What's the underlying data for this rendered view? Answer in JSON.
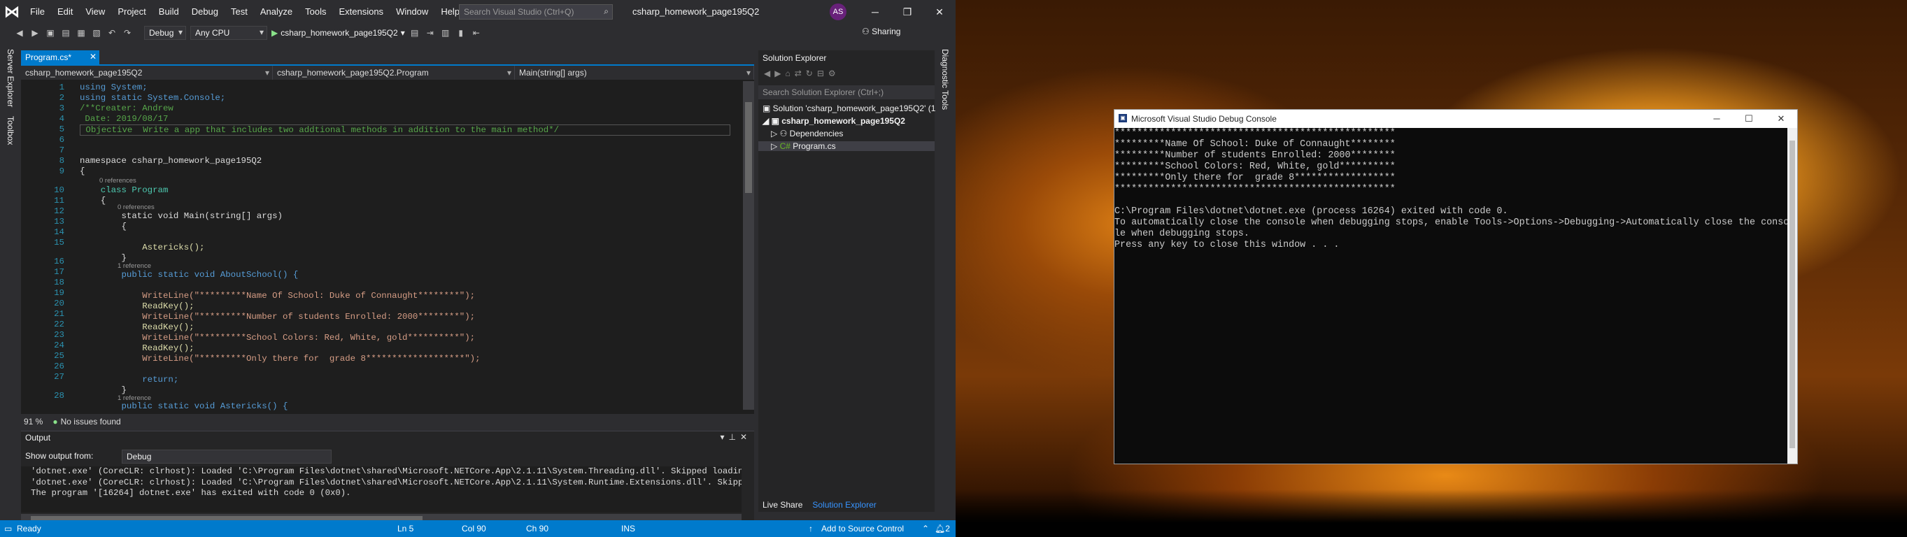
{
  "app": {
    "menu": [
      "File",
      "Edit",
      "View",
      "Project",
      "Build",
      "Debug",
      "Test",
      "Analyze",
      "Tools",
      "Extensions",
      "Window",
      "Help"
    ],
    "search_placeholder": "Search Visual Studio (Ctrl+Q)",
    "solution_name": "csharp_homework_page195Q2",
    "user_initials": "AS",
    "config": "Debug",
    "platform": "Any CPU",
    "run_target": "csharp_homework_page195Q2",
    "sharing": "Sharing",
    "accent": "#007acc"
  },
  "left_tabs": [
    "Server Explorer",
    "Toolbox"
  ],
  "right_tabs": [
    "Diagnostic Tools"
  ],
  "editor": {
    "tab": "Program.cs*",
    "nav": [
      "csharp_homework_page195Q2",
      "csharp_homework_page195Q2.Program",
      "Main(string[] args)"
    ],
    "zoom": "91 %",
    "issues": "No issues found",
    "line_numbers": [
      "1",
      "2",
      "3",
      "4",
      "5",
      "6",
      "7",
      "8",
      "9",
      "10",
      "11",
      "12",
      "13",
      "14",
      "15",
      "16",
      "17",
      "18",
      "19",
      "20",
      "21",
      "22",
      "23",
      "24",
      "25",
      "26",
      "27",
      "28"
    ],
    "refs": [
      "0 references",
      "0 references",
      "1 reference",
      "1 reference"
    ],
    "lines": [
      "using System;",
      "using static System.Console;",
      "/**Creater: Andrew",
      " Date: 2019/08/17",
      " Objective  Write a app that includes two addtional methods in addition to the main method*/",
      "",
      "",
      "namespace csharp_homework_page195Q2",
      "{",
      "    class Program",
      "    {",
      "        static void Main(string[] args)",
      "        {",
      "",
      "            Astericks();",
      "        }",
      "        public static void AboutSchool() {",
      "",
      "            WriteLine(\"*********Name Of School: Duke of Connaught********\");",
      "            ReadKey();",
      "            WriteLine(\"*********Number of students Enrolled: 2000********\");",
      "            ReadKey();",
      "            WriteLine(\"*********School Colors: Red, White, gold**********\");",
      "            ReadKey();",
      "            WriteLine(\"*********Only there for  grade 8*******************\");",
      "",
      "            return;",
      "        }",
      "        public static void Astericks() {"
    ]
  },
  "output": {
    "title": "Output",
    "show_from_label": "Show output from:",
    "source": "Debug",
    "lines": [
      "'dotnet.exe' (CoreCLR: clrhost): Loaded 'C:\\Program Files\\dotnet\\shared\\Microsoft.NETCore.App\\2.1.11\\System.Threading.dll'. Skipped loading symbo",
      "'dotnet.exe' (CoreCLR: clrhost): Loaded 'C:\\Program Files\\dotnet\\shared\\Microsoft.NETCore.App\\2.1.11\\System.Runtime.Extensions.dll'. Skipped load",
      "The program '[16264] dotnet.exe' has exited with code 0 (0x0)."
    ]
  },
  "solution_explorer": {
    "title": "Solution Explorer",
    "search_placeholder": "Search Solution Explorer (Ctrl+;)",
    "solution": "Solution 'csharp_homework_page195Q2' (1",
    "project": "csharp_homework_page195Q2",
    "items": [
      "Dependencies",
      "Program.cs"
    ],
    "bottom_tabs": [
      "Live Share",
      "Solution Explorer"
    ]
  },
  "status": {
    "ready": "Ready",
    "ln": "Ln 5",
    "col": "Col 90",
    "ch": "Ch 90",
    "ins": "INS",
    "source_control": "Add to Source Control",
    "notifications": "2"
  },
  "console": {
    "title": "Microsoft Visual Studio Debug Console",
    "lines": [
      "**************************************************",
      "*********Name Of School: Duke of Connaught********",
      "*********Number of students Enrolled: 2000********",
      "*********School Colors: Red, White, gold**********",
      "*********Only there for  grade 8******************",
      "**************************************************",
      "",
      "C:\\Program Files\\dotnet\\dotnet.exe (process 16264) exited with code 0.",
      "To automatically close the console when debugging stops, enable Tools->Options->Debugging->Automatically close the conso",
      "le when debugging stops.",
      "Press any key to close this window . . ."
    ]
  }
}
